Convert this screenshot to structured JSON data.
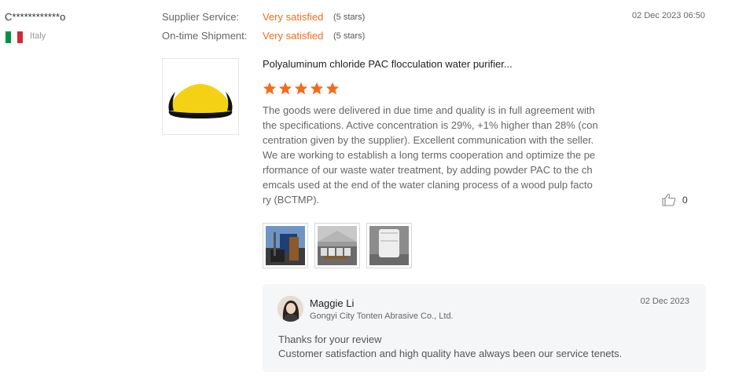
{
  "reviewer": {
    "name": "C************o",
    "country": "Italy",
    "flag_colors": [
      "#009246",
      "#ffffff",
      "#ce2b37"
    ]
  },
  "ratings": [
    {
      "label": "Supplier Service:",
      "value": "Very satisfied",
      "stars_text": "(5 stars)"
    },
    {
      "label": "On-time Shipment:",
      "value": "Very satisfied",
      "stars_text": "(5 stars)"
    }
  ],
  "review": {
    "date": "02 Dec 2023 06:50",
    "product_title": "Polyaluminum chloride PAC flocculation water purifier...",
    "star_rating": 5,
    "star_color": "#f26c1d",
    "text": "The goods were delivered in due time and quality is in full agreement with\nthe specifications. Active concentration is 29%, +1% higher than 28% (con\ncentration given by the supplier). Excellent communication with the seller.\nWe are working to establish a long terms cooperation and optimize the pe\nrformance of our waste water treatment, by adding powder PAC to the ch\nemcals used at the end of the water claning process of a wood pulp facto\nry (BCTMP).",
    "like_count": "0",
    "photos": [
      "forklift-truck-loading",
      "warehouse-bags",
      "bulk-bag"
    ]
  },
  "reply": {
    "seller_name": "Maggie Li",
    "company": "Gongyi City Tonten Abrasive Co., Ltd.",
    "date": "02 Dec 2023",
    "lines": [
      "Thanks for your review",
      "Customer satisfaction and high quality have always been our service tenets."
    ]
  },
  "icons": {
    "star": "star-icon",
    "like": "thumbs-up-icon"
  }
}
